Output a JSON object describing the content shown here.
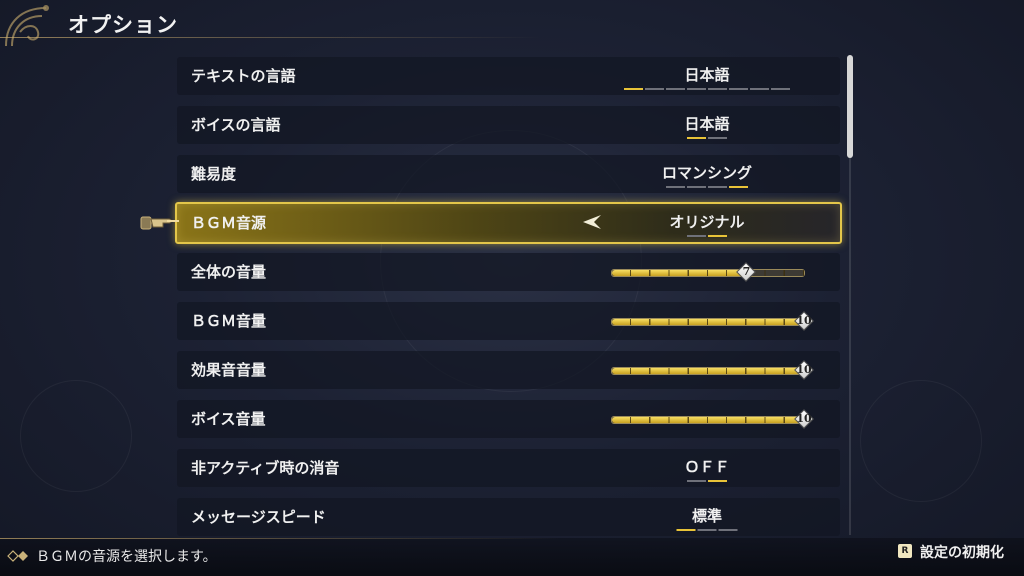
{
  "title": "オプション",
  "rows": [
    {
      "label": "テキストの言語",
      "value": "日本語",
      "segments": 8,
      "active": 0
    },
    {
      "label": "ボイスの言語",
      "value": "日本語",
      "segments": 2,
      "active": 0
    },
    {
      "label": "難易度",
      "value": "ロマンシング",
      "segments": 4,
      "active": 3
    },
    {
      "label": "ＢＧＭ音源",
      "value": "オリジナル",
      "segments": 2,
      "active": 1,
      "selected": true
    },
    {
      "label": "全体の音量",
      "level": 7,
      "max": 10,
      "knob": "7"
    },
    {
      "label": "ＢＧＭ音量",
      "level": 10,
      "max": 10,
      "knob": "10"
    },
    {
      "label": "効果音音量",
      "level": 10,
      "max": 10,
      "knob": "10"
    },
    {
      "label": "ボイス音量",
      "level": 10,
      "max": 10,
      "knob": "10"
    },
    {
      "label": "非アクティブ時の消音",
      "value": "ＯＦＦ",
      "segments": 2,
      "active": 1
    },
    {
      "label": "メッセージスピード",
      "value": "標準",
      "segments": 3,
      "active": 0
    }
  ],
  "footer": {
    "hint": "ＢＧＭの音源を選択します。",
    "reset_key": "R",
    "reset_label": "設定の初期化"
  },
  "scroll": {
    "position": 0,
    "visible_fraction": 0.21
  },
  "colors": {
    "accent": "#e8c338",
    "selected_border": "#e3c64a",
    "inactive_segment": "#6f717a"
  }
}
